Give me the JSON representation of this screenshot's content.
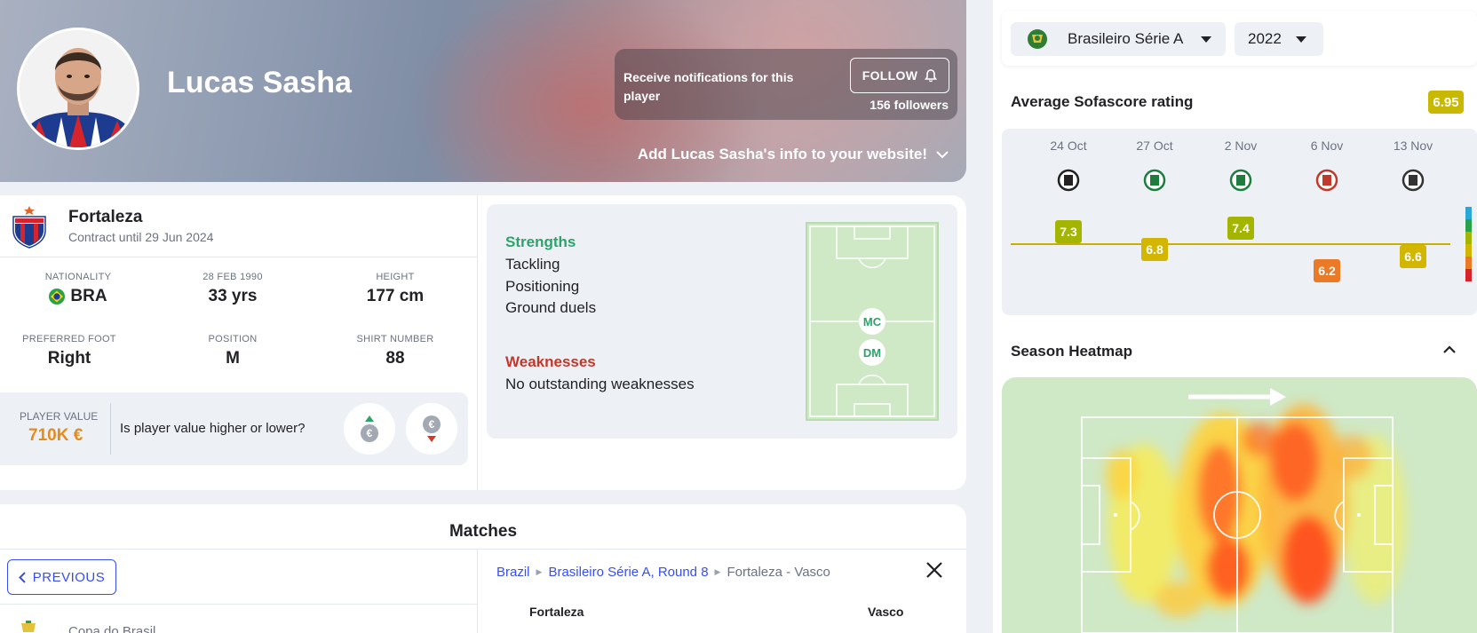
{
  "header": {
    "player_name": "Lucas Sasha",
    "notify_text": "Receive notifications for this player",
    "follow_label": "FOLLOW",
    "followers": "156 followers",
    "add_info": "Add Lucas Sasha's info to your website!"
  },
  "profile": {
    "team": "Fortaleza",
    "contract": "Contract until 29 Jun 2024",
    "stats": [
      {
        "label": "NATIONALITY",
        "value": "BRA"
      },
      {
        "label": "28 FEB 1990",
        "value": "33 yrs"
      },
      {
        "label": "HEIGHT",
        "value": "177 cm"
      },
      {
        "label": "PREFERRED FOOT",
        "value": "Right"
      },
      {
        "label": "POSITION",
        "value": "M"
      },
      {
        "label": "SHIRT NUMBER",
        "value": "88"
      }
    ],
    "player_value_label": "PLAYER VALUE",
    "player_value": "710K €",
    "value_question": "Is player value higher or lower?"
  },
  "attributes": {
    "strengths_title": "Strengths",
    "strengths": [
      "Tackling",
      "Positioning",
      "Ground duels"
    ],
    "weaknesses_title": "Weaknesses",
    "weaknesses": [
      "No outstanding weaknesses"
    ],
    "positions": [
      "MC",
      "DM"
    ]
  },
  "matches": {
    "title": "Matches",
    "previous_label": "PREVIOUS",
    "first_competition": "Copa do Brasil",
    "breadcrumb": [
      "Brazil",
      "Brasileiro Série A, Round 8",
      "Fortaleza - Vasco"
    ],
    "home_team": "Fortaleza",
    "away_team": "Vasco"
  },
  "sidebar": {
    "league": "Brasileiro Série A",
    "season": "2022",
    "rating_title": "Average Sofascore rating",
    "average_rating": "6.95",
    "heatmap_title": "Season Heatmap"
  },
  "chart_data": {
    "type": "line",
    "x": [
      "24 Oct",
      "27 Oct",
      "2 Nov",
      "6 Nov",
      "13 Nov"
    ],
    "values": [
      7.3,
      6.8,
      7.4,
      6.2,
      6.6
    ],
    "reference": 6.95,
    "colors": {
      "high": "#a4b500",
      "mid": "#d2b600",
      "low": "#ea7a25"
    }
  },
  "colors": {
    "accent": "#374df5",
    "strengths": "#2ca36a",
    "weaknesses": "#c0392b",
    "value": "#e38c1e"
  }
}
